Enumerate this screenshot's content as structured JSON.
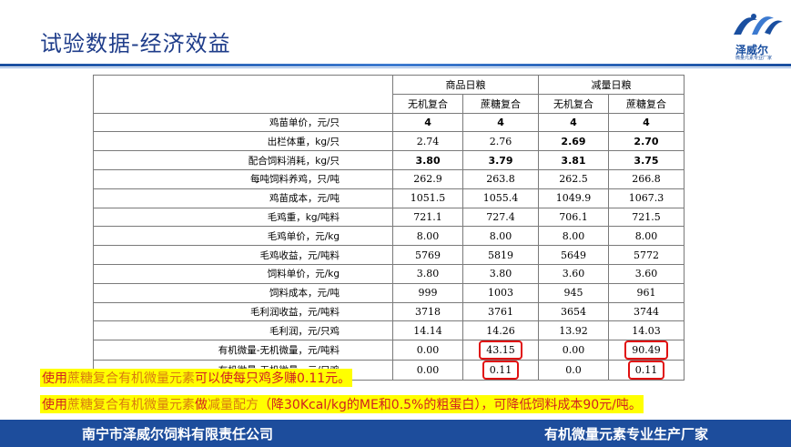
{
  "header": {
    "title": "试验数据-经济效益",
    "logo_text": "泽威尔",
    "logo_sub": "微量元素专业厂家"
  },
  "table": {
    "group_headers": [
      "商品日粮",
      "减量日粮"
    ],
    "sub_headers": [
      "无机复合",
      "蔗糖复合",
      "无机复合",
      "蔗糖复合"
    ],
    "rows": [
      {
        "label": "鸡苗单价，元/只",
        "values": [
          "4",
          "4",
          "4",
          "4"
        ]
      },
      {
        "label": "出栏体重，kg/只",
        "values": [
          "2.74",
          "2.76",
          "2.69",
          "2.70"
        ]
      },
      {
        "label": "配合饲料消耗，kg/只",
        "values": [
          "3.80",
          "3.79",
          "3.81",
          "3.75"
        ]
      },
      {
        "label": "每吨饲料养鸡，只/吨",
        "values": [
          "262.9",
          "263.8",
          "262.5",
          "266.8"
        ]
      },
      {
        "label": "鸡苗成本，元/吨",
        "values": [
          "1051.5",
          "1055.4",
          "1049.9",
          "1067.3"
        ]
      },
      {
        "label": "毛鸡重，kg/吨料",
        "values": [
          "721.1",
          "727.4",
          "706.1",
          "721.5"
        ]
      },
      {
        "label": "毛鸡单价，元/kg",
        "values": [
          "8.00",
          "8.00",
          "8.00",
          "8.00"
        ]
      },
      {
        "label": "毛鸡收益，元/吨料",
        "values": [
          "5769",
          "5819",
          "5649",
          "5772"
        ]
      },
      {
        "label": "饲料单价，元/kg",
        "values": [
          "3.80",
          "3.80",
          "3.60",
          "3.60"
        ]
      },
      {
        "label": "饲料成本，元/吨",
        "values": [
          "999",
          "1003",
          "945",
          "961"
        ]
      },
      {
        "label": "毛利润收益，元/吨料",
        "values": [
          "3718",
          "3761",
          "3654",
          "3744"
        ]
      },
      {
        "label": "毛利润，元/只鸡",
        "values": [
          "14.14",
          "14.26",
          "13.92",
          "14.03"
        ]
      },
      {
        "label": "有机微量-无机微量，元/吨料",
        "values": [
          "0.00",
          "43.15",
          "0.00",
          "90.49"
        ]
      },
      {
        "label": "有机微量-无机微量，元/只鸡",
        "values": [
          "0.00",
          "0.11",
          "0.0",
          "0.11"
        ]
      }
    ]
  },
  "notes": {
    "line1_a": "使用",
    "line1_b": "蔗糖复合有机微量元素",
    "line1_c": "可以使每只鸡多赚0.11元。",
    "line2_a": "使用",
    "line2_b": "蔗糖复合有机微量元素",
    "line2_c": "做",
    "line2_d": "减量配方",
    "line2_e": "（降30Kcal/kg的ME和0.5%的粗蛋白），可降低饲料成本90元/吨。"
  },
  "footer": {
    "company": "南宁市泽威尔饲料有限责任公司",
    "slogan": "有机微量元素专业生产厂家"
  },
  "colors": {
    "brand_blue": "#1d4d9c",
    "highlight_red": "#e01010",
    "note_bg": "#ffff00"
  }
}
